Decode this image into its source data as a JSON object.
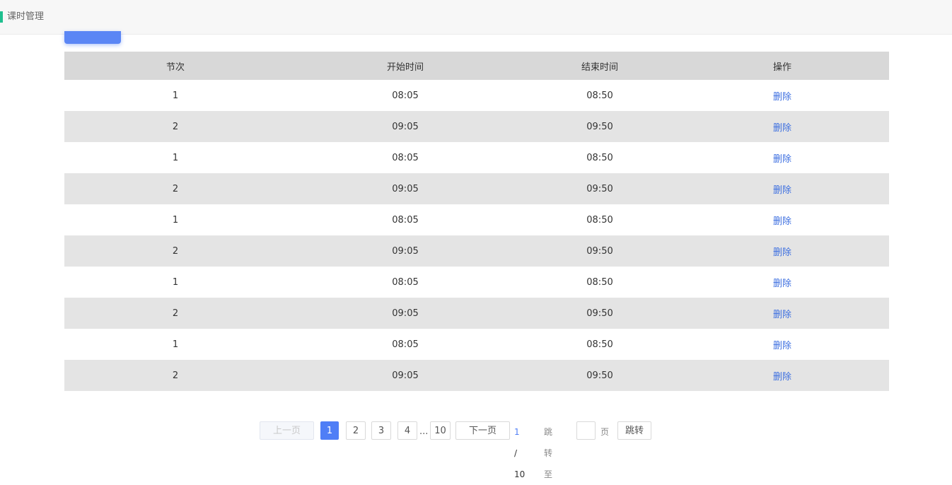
{
  "header": {
    "title": "课时管理"
  },
  "table": {
    "columns": [
      "节次",
      "开始时间",
      "结束时间",
      "操作"
    ],
    "rows": [
      {
        "period": "1",
        "start": "08:05",
        "end": "08:50",
        "action": "删除"
      },
      {
        "period": "2",
        "start": "09:05",
        "end": "09:50",
        "action": "删除"
      },
      {
        "period": "1",
        "start": "08:05",
        "end": "08:50",
        "action": "删除"
      },
      {
        "period": "2",
        "start": "09:05",
        "end": "09:50",
        "action": "删除"
      },
      {
        "period": "1",
        "start": "08:05",
        "end": "08:50",
        "action": "删除"
      },
      {
        "period": "2",
        "start": "09:05",
        "end": "09:50",
        "action": "删除"
      },
      {
        "period": "1",
        "start": "08:05",
        "end": "08:50",
        "action": "删除"
      },
      {
        "period": "2",
        "start": "09:05",
        "end": "09:50",
        "action": "删除"
      },
      {
        "period": "1",
        "start": "08:05",
        "end": "08:50",
        "action": "删除"
      },
      {
        "period": "2",
        "start": "09:05",
        "end": "09:50",
        "action": "删除"
      }
    ]
  },
  "pagination": {
    "prev_label": "上一页",
    "pages": [
      "1",
      "2",
      "3",
      "4"
    ],
    "ellipsis": "...",
    "last_page": "10",
    "next_label": "下一页",
    "current": "1",
    "separator": "/",
    "total": "10",
    "jump_to_label": "跳转至",
    "page_unit": "页",
    "jump_input_value": "",
    "jump_button": "跳转"
  },
  "colors": {
    "accent": "#1fbf8f",
    "primary": "#4f7ef6",
    "link": "#3d6fe0",
    "header_bg": "#d8d8d8",
    "stripe_bg": "#e4e4e4"
  }
}
